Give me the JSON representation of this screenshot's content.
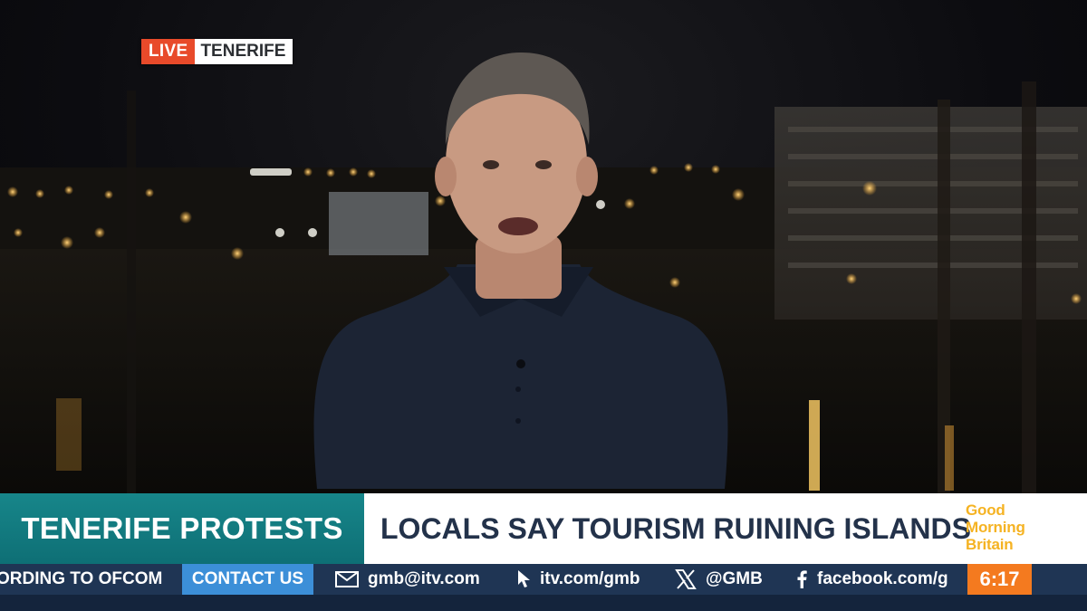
{
  "live_bug": {
    "live_label": "LIVE",
    "location": "TENERIFE"
  },
  "lower_third": {
    "topic": "TENERIFE PROTESTS",
    "headline": "LOCALS SAY TOURISM RUINING ISLANDS"
  },
  "logo": {
    "line1": "Good",
    "line2": "Morning",
    "line3": "Britain"
  },
  "ticker": {
    "scroll_text": "ORDING TO OFCOM",
    "contact_label": "CONTACT US",
    "email": "gmb@itv.com",
    "website": "itv.com/gmb",
    "x_handle": "@GMB",
    "facebook": "facebook.com/g",
    "clock": "6:17"
  },
  "icons": {
    "email": "envelope-icon",
    "website": "cursor-icon",
    "x": "x-logo-icon",
    "facebook": "facebook-icon"
  },
  "colors": {
    "live_red": "#e84a2a",
    "topic_teal": "#17868a",
    "headline_navy": "#23324a",
    "ticker_navy": "#1f3554",
    "contact_blue": "#3c8fd8",
    "clock_orange": "#f47a1f",
    "logo_yellow": "#f5b323"
  }
}
